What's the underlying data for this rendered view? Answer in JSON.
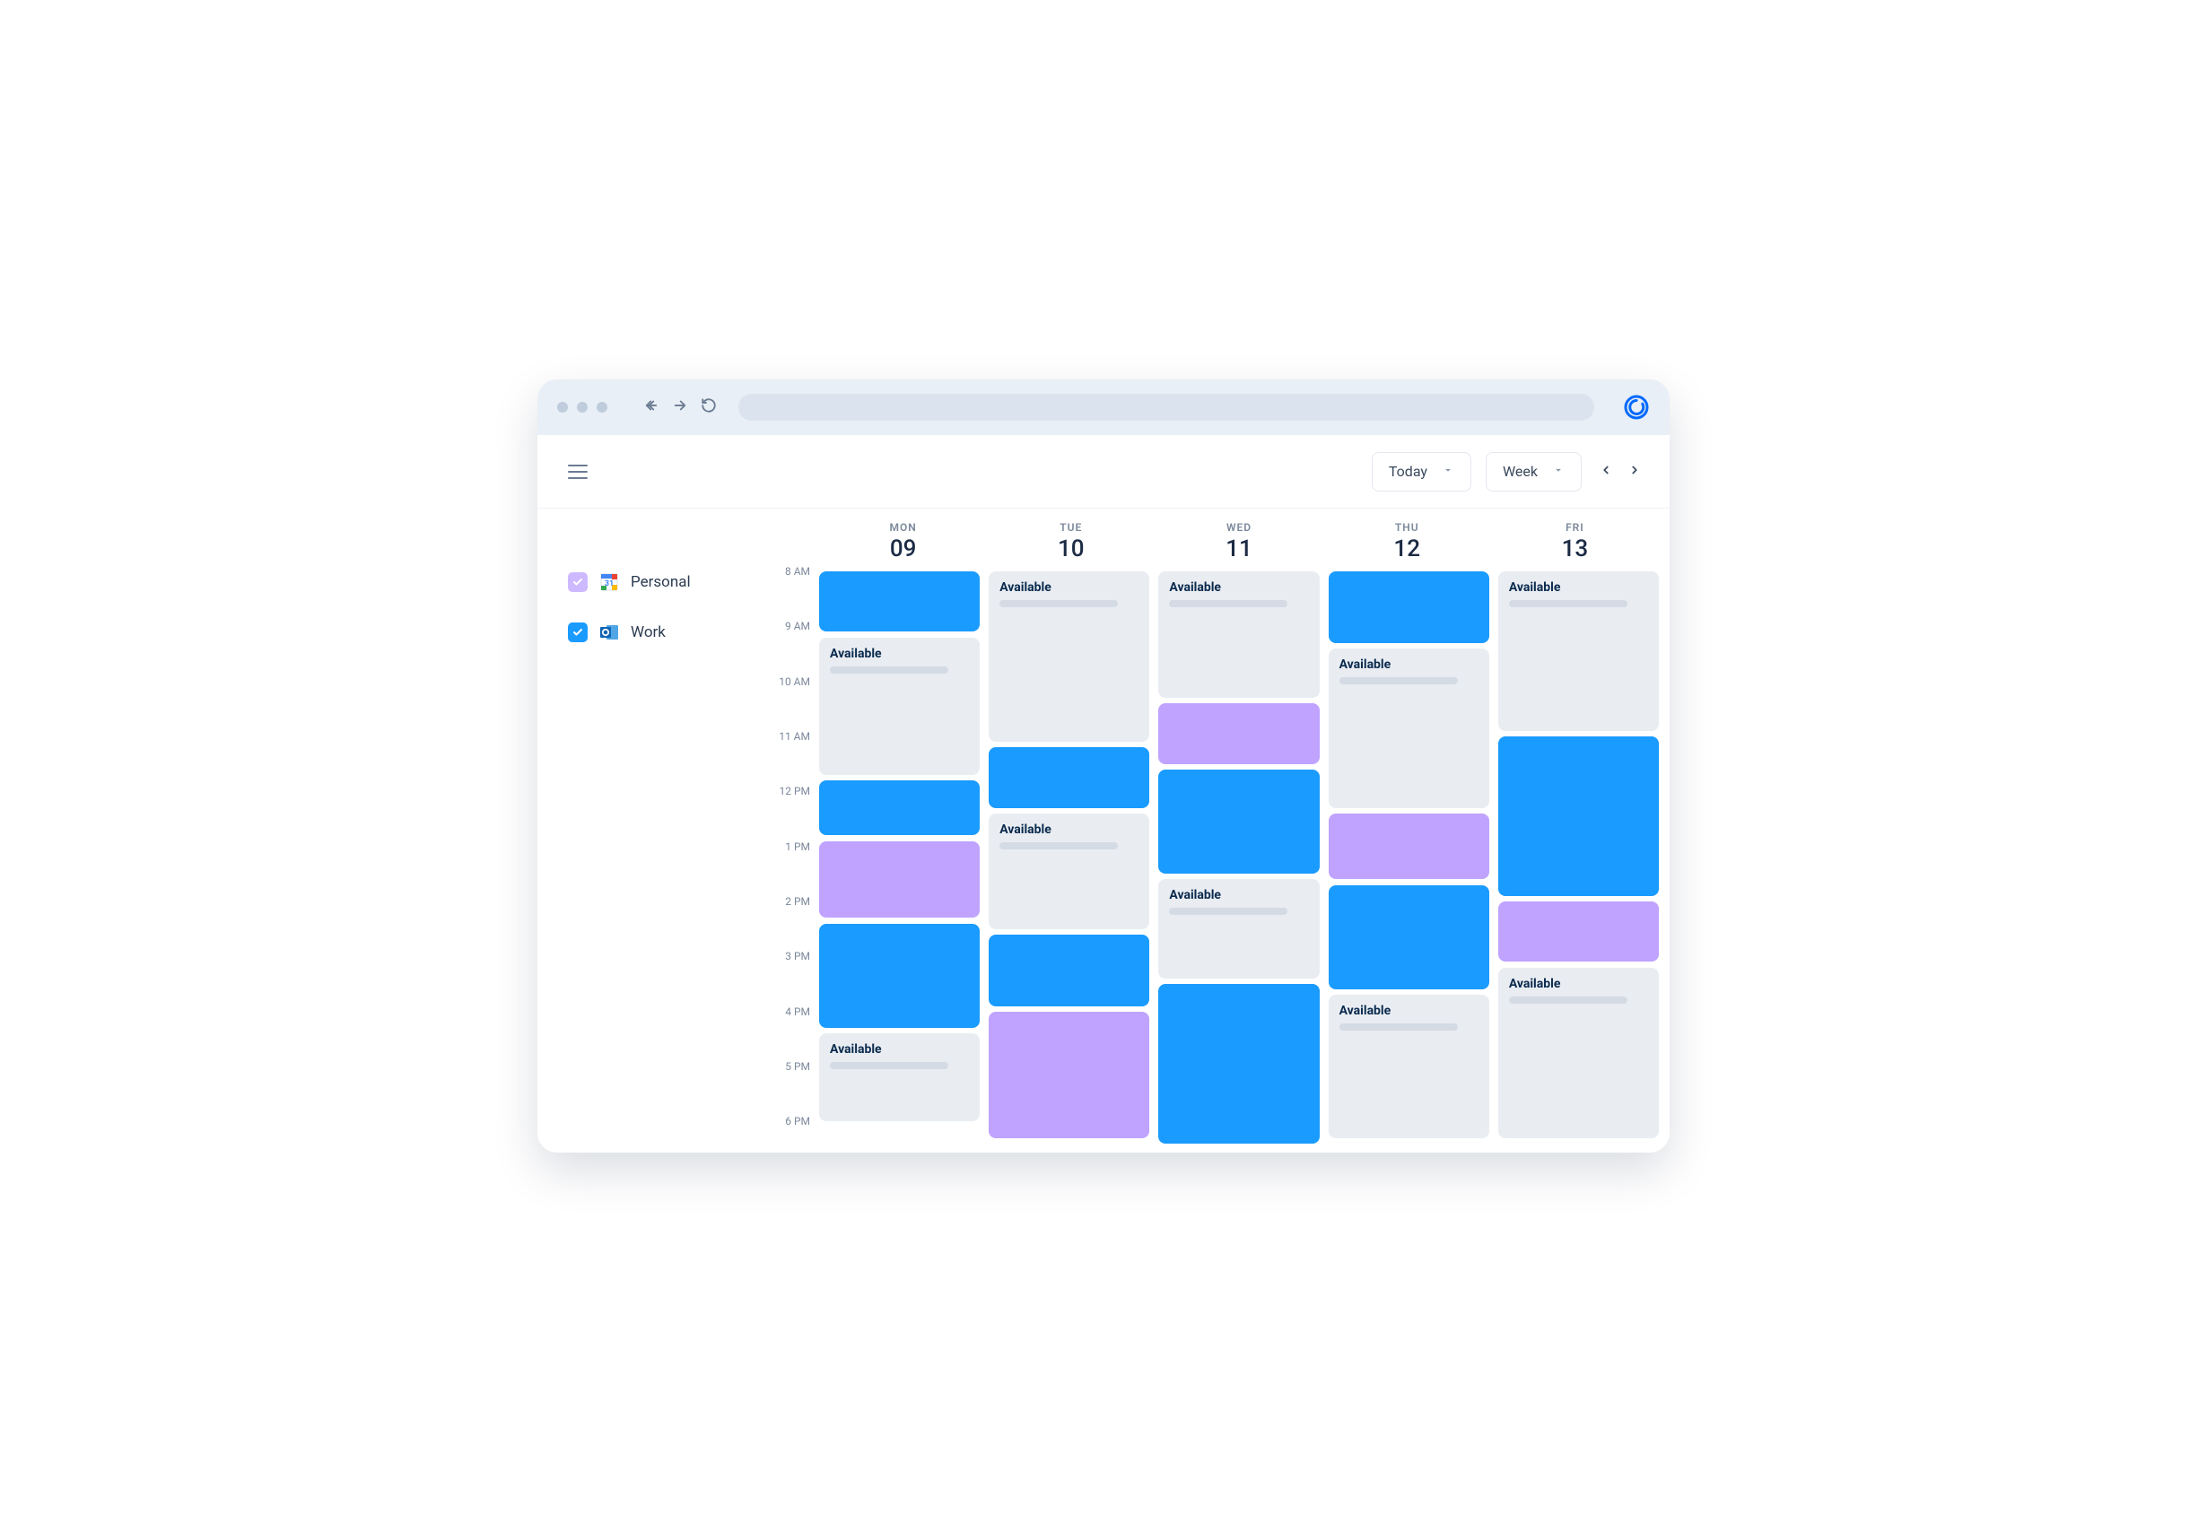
{
  "header": {
    "today_label": "Today",
    "view_label": "Week"
  },
  "sidebar": {
    "calendars": [
      {
        "id": "personal",
        "label": "Personal",
        "checked": true,
        "provider": "google"
      },
      {
        "id": "work",
        "label": "Work",
        "checked": true,
        "provider": "outlook"
      }
    ]
  },
  "calendar": {
    "available_label": "Available",
    "time_slots": [
      "8 AM",
      "9 AM",
      "10 AM",
      "11 AM",
      "12 PM",
      "1 PM",
      "2 PM",
      "3 PM",
      "4 PM",
      "5 PM",
      "6 PM"
    ],
    "hour_start": 8,
    "hour_end": 18.5,
    "days": [
      {
        "dow": "MON",
        "num": "09",
        "events": [
          {
            "type": "blue",
            "start": 8.0,
            "end": 9.1
          },
          {
            "type": "avail",
            "start": 9.2,
            "end": 11.7
          },
          {
            "type": "blue",
            "start": 11.8,
            "end": 12.8
          },
          {
            "type": "purple",
            "start": 12.9,
            "end": 14.3
          },
          {
            "type": "blue",
            "start": 14.4,
            "end": 16.3
          },
          {
            "type": "avail",
            "start": 16.4,
            "end": 18.0
          }
        ]
      },
      {
        "dow": "TUE",
        "num": "10",
        "events": [
          {
            "type": "avail",
            "start": 8.0,
            "end": 11.1
          },
          {
            "type": "blue",
            "start": 11.2,
            "end": 12.3
          },
          {
            "type": "avail",
            "start": 12.4,
            "end": 14.5
          },
          {
            "type": "blue",
            "start": 14.6,
            "end": 15.9
          },
          {
            "type": "purple",
            "start": 16.0,
            "end": 18.3
          }
        ]
      },
      {
        "dow": "WED",
        "num": "11",
        "events": [
          {
            "type": "avail",
            "start": 8.0,
            "end": 10.3
          },
          {
            "type": "purple",
            "start": 10.4,
            "end": 11.5
          },
          {
            "type": "blue",
            "start": 11.6,
            "end": 13.5
          },
          {
            "type": "avail",
            "start": 13.6,
            "end": 15.4
          },
          {
            "type": "blue",
            "start": 15.5,
            "end": 18.4
          }
        ]
      },
      {
        "dow": "THU",
        "num": "12",
        "events": [
          {
            "type": "blue",
            "start": 8.0,
            "end": 9.3
          },
          {
            "type": "avail",
            "start": 9.4,
            "end": 12.3
          },
          {
            "type": "purple",
            "start": 12.4,
            "end": 13.6
          },
          {
            "type": "blue",
            "start": 13.7,
            "end": 15.6
          },
          {
            "type": "avail",
            "start": 15.7,
            "end": 18.3
          }
        ]
      },
      {
        "dow": "FRI",
        "num": "13",
        "events": [
          {
            "type": "avail",
            "start": 8.0,
            "end": 10.9
          },
          {
            "type": "blue",
            "start": 11.0,
            "end": 13.9
          },
          {
            "type": "purple",
            "start": 14.0,
            "end": 15.1
          },
          {
            "type": "avail",
            "start": 15.2,
            "end": 18.3
          }
        ]
      }
    ]
  }
}
